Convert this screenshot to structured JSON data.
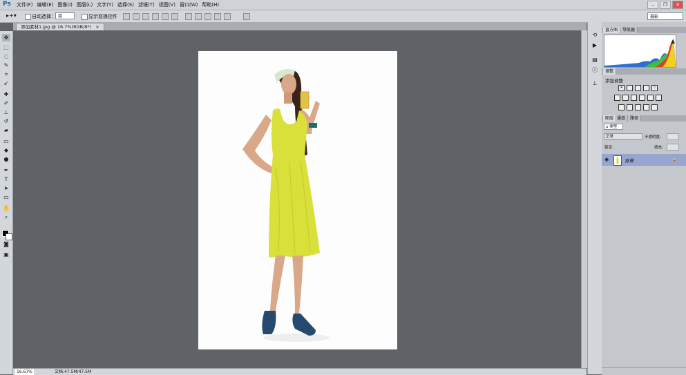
{
  "app": {
    "logo": "Ps"
  },
  "menu": [
    "文件(F)",
    "编辑(E)",
    "图像(I)",
    "图层(L)",
    "文字(Y)",
    "选择(S)",
    "滤镜(T)",
    "视图(V)",
    "窗口(W)",
    "帮助(H)"
  ],
  "window_controls": {
    "minimize": "–",
    "restore": "❐",
    "close": "✕"
  },
  "options": {
    "auto_select_label": "自动选择：",
    "auto_select_value": "组",
    "show_transform_label": "显示变换控件",
    "workspace": "摄影"
  },
  "document": {
    "tab_title": "添加素材1.jpg @ 16.7%(RGB/8*)",
    "tab_close": "×",
    "zoom": "16.67%",
    "info": "文档:47.5M/47.5M"
  },
  "panels": {
    "histogram_tab": "直方图",
    "navigator_tab": "导航器",
    "adjust_tab": "调整",
    "adjust_title": "添加调整",
    "layers_tab": "图层",
    "channels_tab": "通道",
    "paths_tab": "路径",
    "filter_kind": "ρ 类型",
    "blend_mode": "正常",
    "opacity_label": "不透明度:",
    "lock_label": "锁定:",
    "fill_label": "填充:",
    "layer_name": "背景"
  },
  "colors": {
    "canvas": "#5f6368",
    "selected_layer": "#97a5cf",
    "dress": "#d9e03a"
  }
}
